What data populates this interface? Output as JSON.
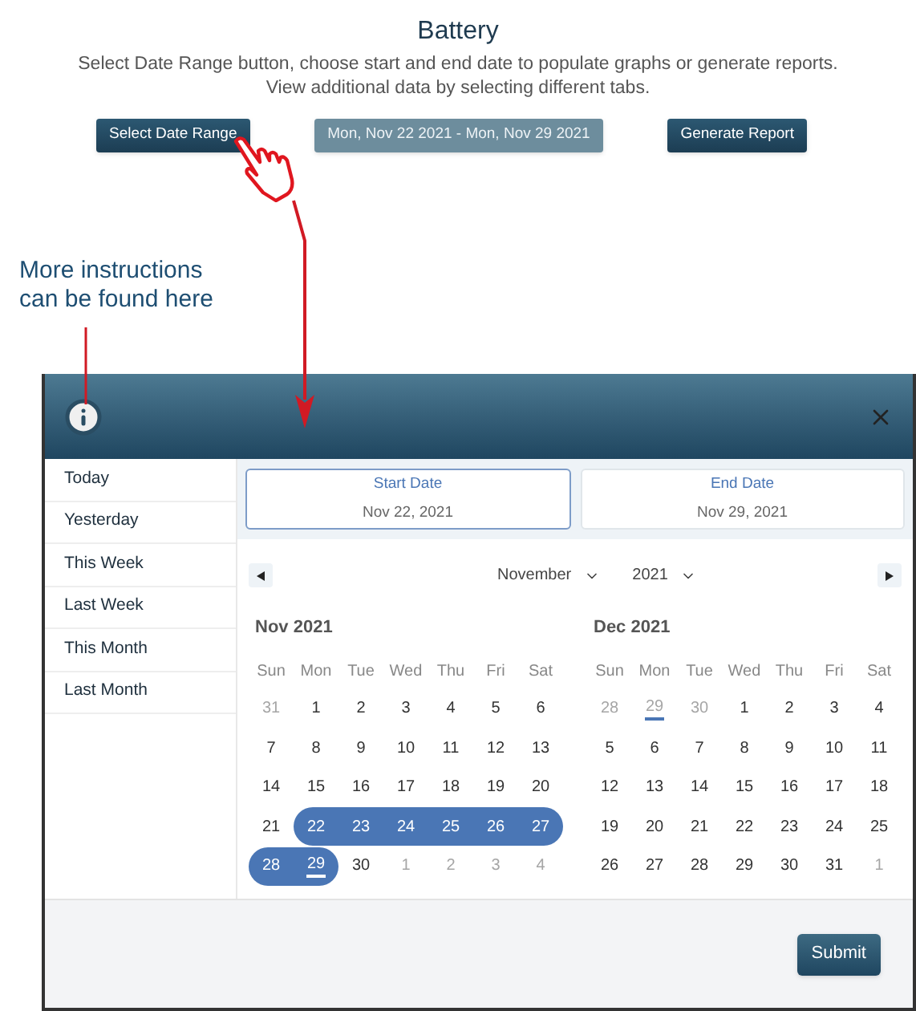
{
  "page": {
    "title": "Battery",
    "description": [
      "Select Date Range button, choose start and end date to populate graphs or generate reports.",
      "View additional data by selecting different tabs."
    ]
  },
  "buttons": [
    {
      "label": "Select Date Range",
      "kind": "primary"
    },
    {
      "label": "Mon, Nov 22 2021 - Mon, Nov 29 2021",
      "kind": "range"
    },
    {
      "label": "Generate Report",
      "kind": "primary"
    }
  ],
  "annotation": {
    "lines": [
      "More instructions",
      "can be found here"
    ]
  },
  "modal": {
    "presets": [
      {
        "label": "Today",
        "selected": false
      },
      {
        "label": "Yesterday",
        "selected": false
      },
      {
        "label": "This Week",
        "selected": false
      },
      {
        "label": "Last Week",
        "selected": false
      },
      {
        "label": "This Month",
        "selected": false
      },
      {
        "label": "Last Month",
        "selected": false
      }
    ],
    "dates": [
      {
        "label": "Start Date",
        "value": "Nov 22, 2021",
        "selected": true
      },
      {
        "label": "End Date",
        "value": "Nov 29, 2021",
        "selected": false
      }
    ],
    "month_select": "November",
    "year_select": "2021",
    "months": [
      {
        "title": "Nov 2021",
        "weekdays": [
          "Sun",
          "Mon",
          "Tue",
          "Wed",
          "Thu",
          "Fri",
          "Sat"
        ],
        "weeks": [
          [
            {
              "day": "31",
              "muted": true,
              "in_range": false,
              "underlined": false
            },
            {
              "day": "1",
              "muted": false,
              "in_range": false,
              "underlined": false
            },
            {
              "day": "2",
              "muted": false,
              "in_range": false,
              "underlined": false
            },
            {
              "day": "3",
              "muted": false,
              "in_range": false,
              "underlined": false
            },
            {
              "day": "4",
              "muted": false,
              "in_range": false,
              "underlined": false
            },
            {
              "day": "5",
              "muted": false,
              "in_range": false,
              "underlined": false
            },
            {
              "day": "6",
              "muted": false,
              "in_range": false,
              "underlined": false
            }
          ],
          [
            {
              "day": "7",
              "muted": false,
              "in_range": false,
              "underlined": false
            },
            {
              "day": "8",
              "muted": false,
              "in_range": false,
              "underlined": false
            },
            {
              "day": "9",
              "muted": false,
              "in_range": false,
              "underlined": false
            },
            {
              "day": "10",
              "muted": false,
              "in_range": false,
              "underlined": false
            },
            {
              "day": "11",
              "muted": false,
              "in_range": false,
              "underlined": false
            },
            {
              "day": "12",
              "muted": false,
              "in_range": false,
              "underlined": false
            },
            {
              "day": "13",
              "muted": false,
              "in_range": false,
              "underlined": false
            }
          ],
          [
            {
              "day": "14",
              "muted": false,
              "in_range": false,
              "underlined": false
            },
            {
              "day": "15",
              "muted": false,
              "in_range": false,
              "underlined": false
            },
            {
              "day": "16",
              "muted": false,
              "in_range": false,
              "underlined": false
            },
            {
              "day": "17",
              "muted": false,
              "in_range": false,
              "underlined": false
            },
            {
              "day": "18",
              "muted": false,
              "in_range": false,
              "underlined": false
            },
            {
              "day": "19",
              "muted": false,
              "in_range": false,
              "underlined": false
            },
            {
              "day": "20",
              "muted": false,
              "in_range": false,
              "underlined": false
            }
          ],
          [
            {
              "day": "21",
              "muted": false,
              "in_range": false,
              "underlined": false
            },
            {
              "day": "22",
              "muted": false,
              "in_range": true,
              "underlined": false
            },
            {
              "day": "23",
              "muted": false,
              "in_range": true,
              "underlined": false
            },
            {
              "day": "24",
              "muted": false,
              "in_range": true,
              "underlined": false
            },
            {
              "day": "25",
              "muted": false,
              "in_range": true,
              "underlined": false
            },
            {
              "day": "26",
              "muted": false,
              "in_range": true,
              "underlined": false
            },
            {
              "day": "27",
              "muted": false,
              "in_range": true,
              "underlined": false
            }
          ],
          [
            {
              "day": "28",
              "muted": false,
              "in_range": true,
              "underlined": false
            },
            {
              "day": "29",
              "muted": false,
              "in_range": true,
              "underlined": true
            },
            {
              "day": "30",
              "muted": false,
              "in_range": false,
              "underlined": false
            },
            {
              "day": "1",
              "muted": true,
              "in_range": false,
              "underlined": false
            },
            {
              "day": "2",
              "muted": true,
              "in_range": false,
              "underlined": false
            },
            {
              "day": "3",
              "muted": true,
              "in_range": false,
              "underlined": false
            },
            {
              "day": "4",
              "muted": true,
              "in_range": false,
              "underlined": false
            }
          ]
        ]
      },
      {
        "title": "Dec 2021",
        "weekdays": [
          "Sun",
          "Mon",
          "Tue",
          "Wed",
          "Thu",
          "Fri",
          "Sat"
        ],
        "weeks": [
          [
            {
              "day": "28",
              "muted": true,
              "in_range": false,
              "underlined": false
            },
            {
              "day": "29",
              "muted": true,
              "in_range": false,
              "underlined": true
            },
            {
              "day": "30",
              "muted": true,
              "in_range": false,
              "underlined": false
            },
            {
              "day": "1",
              "muted": false,
              "in_range": false,
              "underlined": false
            },
            {
              "day": "2",
              "muted": false,
              "in_range": false,
              "underlined": false
            },
            {
              "day": "3",
              "muted": false,
              "in_range": false,
              "underlined": false
            },
            {
              "day": "4",
              "muted": false,
              "in_range": false,
              "underlined": false
            }
          ],
          [
            {
              "day": "5",
              "muted": false,
              "in_range": false,
              "underlined": false
            },
            {
              "day": "6",
              "muted": false,
              "in_range": false,
              "underlined": false
            },
            {
              "day": "7",
              "muted": false,
              "in_range": false,
              "underlined": false
            },
            {
              "day": "8",
              "muted": false,
              "in_range": false,
              "underlined": false
            },
            {
              "day": "9",
              "muted": false,
              "in_range": false,
              "underlined": false
            },
            {
              "day": "10",
              "muted": false,
              "in_range": false,
              "underlined": false
            },
            {
              "day": "11",
              "muted": false,
              "in_range": false,
              "underlined": false
            }
          ],
          [
            {
              "day": "12",
              "muted": false,
              "in_range": false,
              "underlined": false
            },
            {
              "day": "13",
              "muted": false,
              "in_range": false,
              "underlined": false
            },
            {
              "day": "14",
              "muted": false,
              "in_range": false,
              "underlined": false
            },
            {
              "day": "15",
              "muted": false,
              "in_range": false,
              "underlined": false
            },
            {
              "day": "16",
              "muted": false,
              "in_range": false,
              "underlined": false
            },
            {
              "day": "17",
              "muted": false,
              "in_range": false,
              "underlined": false
            },
            {
              "day": "18",
              "muted": false,
              "in_range": false,
              "underlined": false
            }
          ],
          [
            {
              "day": "19",
              "muted": false,
              "in_range": false,
              "underlined": false
            },
            {
              "day": "20",
              "muted": false,
              "in_range": false,
              "underlined": false
            },
            {
              "day": "21",
              "muted": false,
              "in_range": false,
              "underlined": false
            },
            {
              "day": "22",
              "muted": false,
              "in_range": false,
              "underlined": false
            },
            {
              "day": "23",
              "muted": false,
              "in_range": false,
              "underlined": false
            },
            {
              "day": "24",
              "muted": false,
              "in_range": false,
              "underlined": false
            },
            {
              "day": "25",
              "muted": false,
              "in_range": false,
              "underlined": false
            }
          ],
          [
            {
              "day": "26",
              "muted": false,
              "in_range": false,
              "underlined": false
            },
            {
              "day": "27",
              "muted": false,
              "in_range": false,
              "underlined": false
            },
            {
              "day": "28",
              "muted": false,
              "in_range": false,
              "underlined": false
            },
            {
              "day": "29",
              "muted": false,
              "in_range": false,
              "underlined": false
            },
            {
              "day": "30",
              "muted": false,
              "in_range": false,
              "underlined": false
            },
            {
              "day": "31",
              "muted": false,
              "in_range": false,
              "underlined": false
            },
            {
              "day": "1",
              "muted": true,
              "in_range": false,
              "underlined": false
            }
          ]
        ]
      }
    ],
    "submit": "Submit"
  }
}
